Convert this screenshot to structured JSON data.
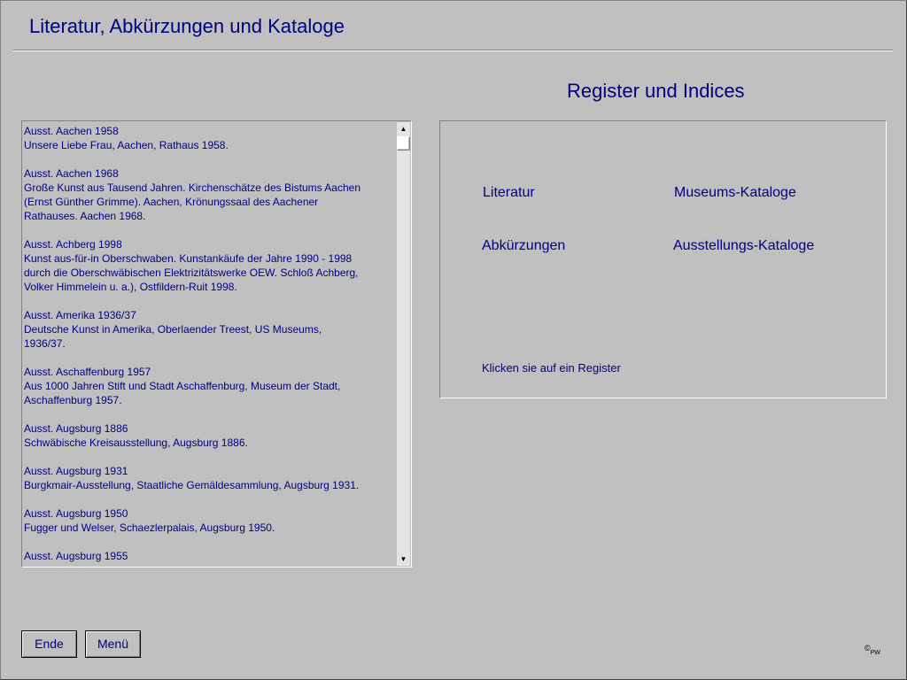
{
  "header": {
    "title": "Literatur, Abkürzungen und Kataloge"
  },
  "list": {
    "entries": [
      {
        "title": "Ausst. Aachen 1958",
        "lines": [
          "Unsere Liebe Frau, Aachen, Rathaus 1958."
        ]
      },
      {
        "title": "Ausst. Aachen 1968",
        "lines": [
          "Große Kunst aus Tausend Jahren. Kirchenschätze des Bistums Aachen",
          "(Ernst Günther Grimme). Aachen, Krönungssaal des Aachener",
          "Rathauses. Aachen 1968."
        ]
      },
      {
        "title": "Ausst. Achberg 1998",
        "lines": [
          "Kunst aus-für-in Oberschwaben. Kunstankäufe der Jahre 1990 - 1998",
          "durch die Oberschwäbischen Elektrizitätswerke OEW. Schloß Achberg,",
          "Volker Himmelein u. a.), Ostfildern-Ruit 1998."
        ]
      },
      {
        "title": "Ausst. Amerika 1936/37",
        "lines": [
          "Deutsche Kunst in Amerika, Oberlaender Treest, US Museums,",
          "1936/37."
        ]
      },
      {
        "title": "Ausst. Aschaffenburg 1957",
        "lines": [
          "Aus 1000 Jahren Stift und Stadt Aschaffenburg, Museum der Stadt,",
          "Aschaffenburg 1957."
        ]
      },
      {
        "title": "Ausst. Augsburg 1886",
        "lines": [
          "Schwäbische Kreisausstellung, Augsburg 1886."
        ]
      },
      {
        "title": "Ausst. Augsburg 1931",
        "lines": [
          "Burgkmair-Ausstellung, Staatliche Gemäldesammlung, Augsburg 1931."
        ]
      },
      {
        "title": "Ausst. Augsburg 1950",
        "lines": [
          "Fugger und Welser, Schaezlerpalais, Augsburg 1950."
        ]
      },
      {
        "title": "Ausst. Augsburg 1955",
        "lines": []
      }
    ]
  },
  "register": {
    "title": "Register und Indices",
    "literatur": "Literatur",
    "museums": "Museums-Kataloge",
    "abkuerzungen": "Abkürzungen",
    "ausstellungs": "Ausstellungs-Kataloge",
    "hint": "Klicken sie auf ein Register"
  },
  "buttons": {
    "ende": "Ende",
    "menue": "Menü"
  },
  "footer": {
    "copyright_symbol": "©",
    "initials": "PW"
  },
  "colors": {
    "background": "#c0c0c0",
    "text": "#000080"
  },
  "icons": {
    "scroll_up": "up-arrow-icon",
    "scroll_down": "down-arrow-icon"
  }
}
